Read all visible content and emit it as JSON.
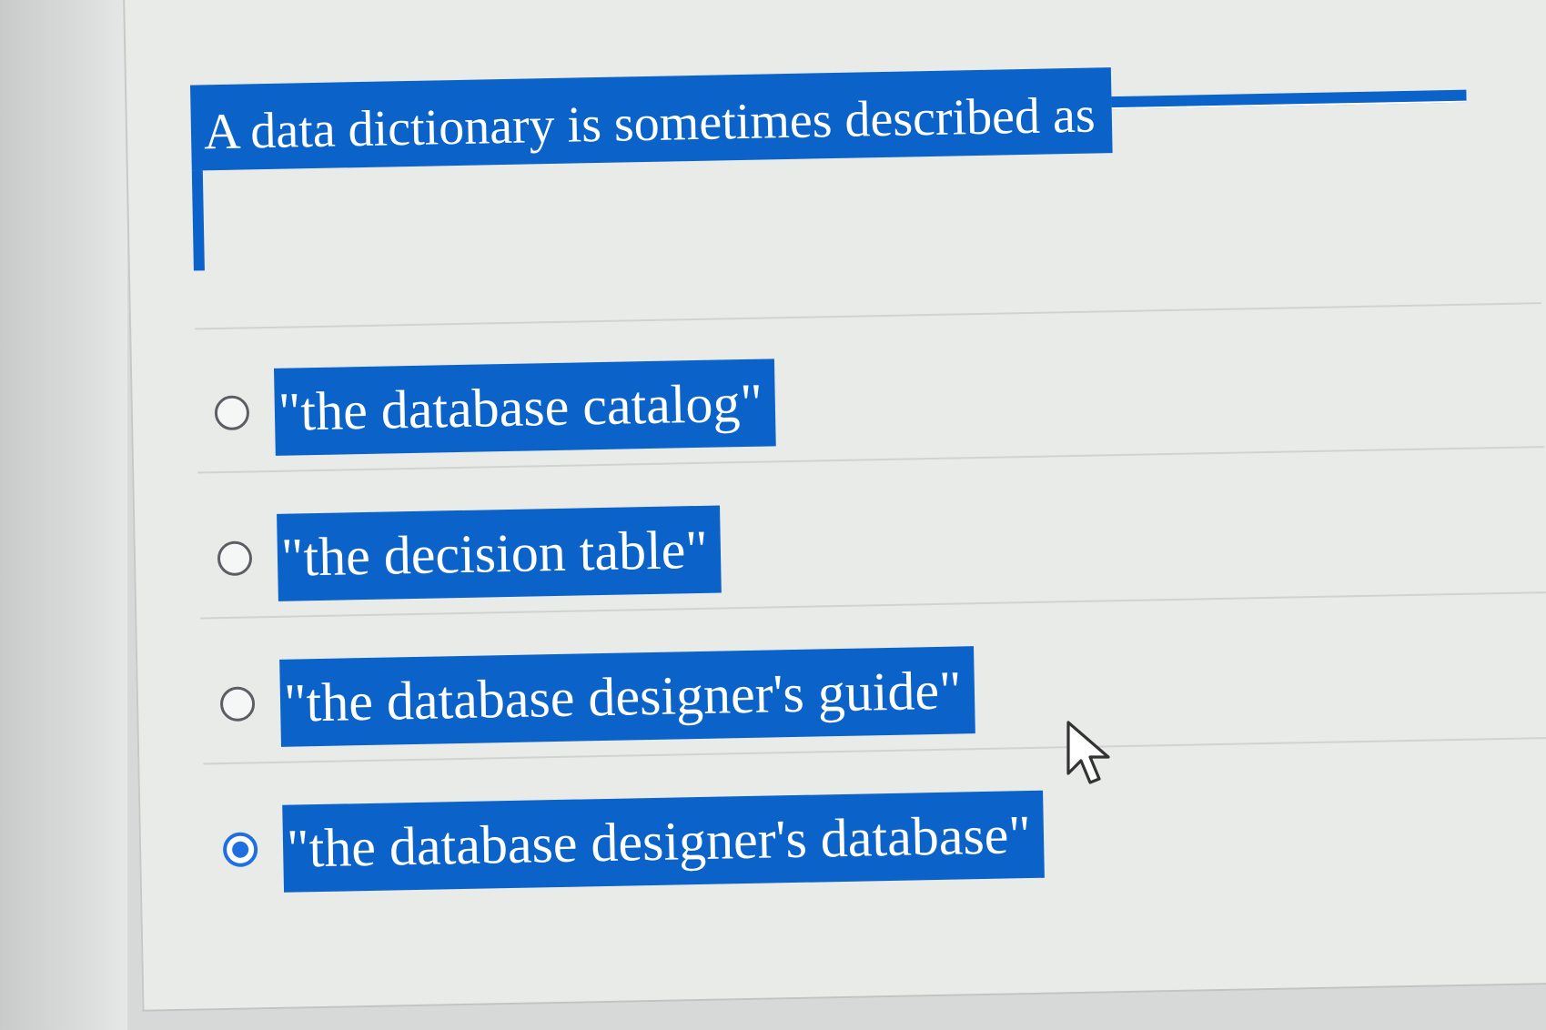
{
  "question": {
    "text": "A data dictionary is sometimes described as"
  },
  "options": [
    {
      "label": "\"the database catalog\"",
      "selected": false
    },
    {
      "label": "\"the decision table\"",
      "selected": false
    },
    {
      "label": "\"the database designer's guide\"",
      "selected": false
    },
    {
      "label": "\"the database designer's database\"",
      "selected": true
    }
  ],
  "colors": {
    "highlight": "#0b63c9",
    "radio_selected": "#1f6fe0",
    "background": "#e9ebe9"
  },
  "icons": {
    "cursor": "mouse-pointer-icon"
  }
}
